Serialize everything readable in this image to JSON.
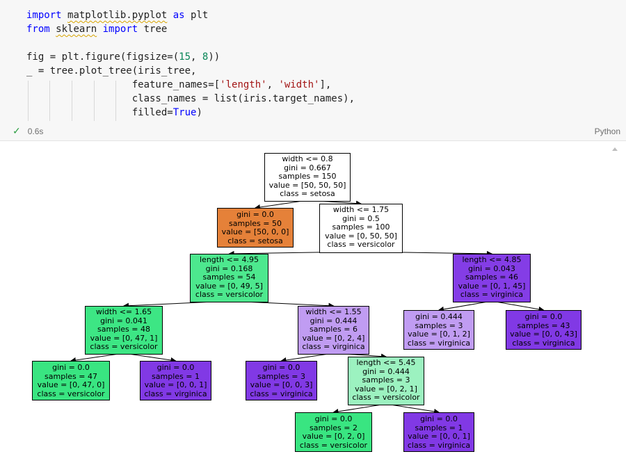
{
  "code_cell": {
    "lines": [
      {
        "seg": [
          [
            "kw",
            "import"
          ],
          [
            "t",
            " "
          ],
          [
            "sq",
            "matplotlib.pyplot"
          ],
          [
            "t",
            " "
          ],
          [
            "kw",
            "as"
          ],
          [
            "t",
            " plt"
          ]
        ]
      },
      {
        "seg": [
          [
            "kw",
            "from"
          ],
          [
            "t",
            " "
          ],
          [
            "sq",
            "sklearn"
          ],
          [
            "t",
            " "
          ],
          [
            "kw",
            "import"
          ],
          [
            "t",
            " tree"
          ]
        ]
      },
      {
        "seg": [
          [
            "t",
            ""
          ]
        ]
      },
      {
        "seg": [
          [
            "t",
            "fig = plt.figure(figsize=("
          ],
          [
            "num",
            "15"
          ],
          [
            "t",
            ", "
          ],
          [
            "num",
            "8"
          ],
          [
            "t",
            "))"
          ]
        ]
      },
      {
        "seg": [
          [
            "t",
            "_ = tree.plot_tree(iris_tree,"
          ]
        ]
      },
      {
        "seg": [
          [
            "t",
            "                  feature_names=["
          ],
          [
            "str",
            "'length'"
          ],
          [
            "t",
            ", "
          ],
          [
            "str",
            "'width'"
          ],
          [
            "t",
            "],"
          ]
        ]
      },
      {
        "seg": [
          [
            "t",
            "                  class_names = list(iris.target_names),"
          ]
        ]
      },
      {
        "seg": [
          [
            "t",
            "                  filled="
          ],
          [
            "kw",
            "True"
          ],
          [
            "t",
            ")"
          ]
        ]
      }
    ]
  },
  "status": {
    "check_icon": "✓",
    "duration": "0.6s",
    "language": "Python"
  },
  "tree": {
    "nodes": [
      {
        "id": "n0",
        "lines": [
          "width <= 0.8",
          "gini = 0.667",
          "samples = 150",
          "value = [50, 50, 50]",
          "class = setosa"
        ],
        "fill": "#ffffff"
      },
      {
        "id": "n1",
        "lines": [
          "gini = 0.0",
          "samples = 50",
          "value = [50, 0, 0]",
          "class = setosa"
        ],
        "fill": "#e58139"
      },
      {
        "id": "n2",
        "lines": [
          "width <= 1.75",
          "gini = 0.5",
          "samples = 100",
          "value = [0, 50, 50]",
          "class = versicolor"
        ],
        "fill": "#ffffff"
      },
      {
        "id": "n3",
        "lines": [
          "length <= 4.95",
          "gini = 0.168",
          "samples = 54",
          "value = [0, 49, 5]",
          "class = versicolor"
        ],
        "fill": "#4de88e"
      },
      {
        "id": "n4",
        "lines": [
          "length <= 4.85",
          "gini = 0.043",
          "samples = 46",
          "value = [0, 1, 45]",
          "class = virginica"
        ],
        "fill": "#843de6"
      },
      {
        "id": "n5",
        "lines": [
          "width <= 1.65",
          "gini = 0.041",
          "samples = 48",
          "value = [0, 47, 1]",
          "class = versicolor"
        ],
        "fill": "#3de684"
      },
      {
        "id": "n6",
        "lines": [
          "width <= 1.55",
          "gini = 0.444",
          "samples = 6",
          "value = [0, 2, 4]",
          "class = virginica"
        ],
        "fill": "#c09cf2"
      },
      {
        "id": "n7",
        "lines": [
          "gini = 0.444",
          "samples = 3",
          "value = [0, 1, 2]",
          "class = virginica"
        ],
        "fill": "#c09cf2"
      },
      {
        "id": "n8",
        "lines": [
          "gini = 0.0",
          "samples = 43",
          "value = [0, 0, 43]",
          "class = virginica"
        ],
        "fill": "#8139e5"
      },
      {
        "id": "n9",
        "lines": [
          "gini = 0.0",
          "samples = 47",
          "value = [0, 47, 0]",
          "class = versicolor"
        ],
        "fill": "#39e581"
      },
      {
        "id": "n10",
        "lines": [
          "gini = 0.0",
          "samples = 1",
          "value = [0, 0, 1]",
          "class = virginica"
        ],
        "fill": "#8139e5"
      },
      {
        "id": "n11",
        "lines": [
          "gini = 0.0",
          "samples = 3",
          "value = [0, 0, 3]",
          "class = virginica"
        ],
        "fill": "#8139e5"
      },
      {
        "id": "n12",
        "lines": [
          "length <= 5.45",
          "gini = 0.444",
          "samples = 3",
          "value = [0, 2, 1]",
          "class = versicolor"
        ],
        "fill": "#9cf2c0"
      },
      {
        "id": "n13",
        "lines": [
          "gini = 0.0",
          "samples = 2",
          "value = [0, 2, 0]",
          "class = versicolor"
        ],
        "fill": "#39e581"
      },
      {
        "id": "n14",
        "lines": [
          "gini = 0.0",
          "samples = 1",
          "value = [0, 0, 1]",
          "class = virginica"
        ],
        "fill": "#8139e5"
      }
    ],
    "edges": [
      [
        "n0",
        "n1"
      ],
      [
        "n0",
        "n2"
      ],
      [
        "n2",
        "n3"
      ],
      [
        "n2",
        "n4"
      ],
      [
        "n3",
        "n5"
      ],
      [
        "n3",
        "n6"
      ],
      [
        "n4",
        "n7"
      ],
      [
        "n4",
        "n8"
      ],
      [
        "n5",
        "n9"
      ],
      [
        "n5",
        "n10"
      ],
      [
        "n6",
        "n11"
      ],
      [
        "n6",
        "n12"
      ],
      [
        "n12",
        "n13"
      ],
      [
        "n12",
        "n14"
      ]
    ]
  }
}
